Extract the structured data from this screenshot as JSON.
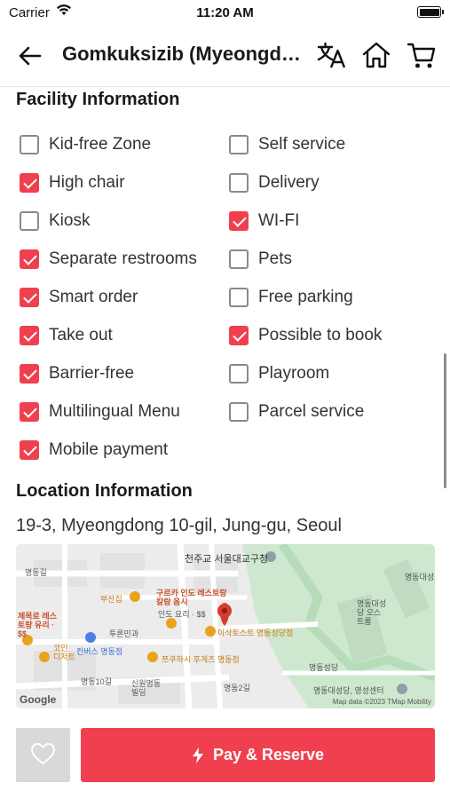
{
  "status_bar": {
    "carrier": "Carrier",
    "time": "11:20 AM"
  },
  "header": {
    "title": "Gomkuksizib (Myeongdong)",
    "icons": [
      "back-arrow-icon",
      "translate-icon",
      "home-icon",
      "cart-icon"
    ]
  },
  "facility": {
    "title": "Facility Information",
    "items": [
      {
        "label": "Kid-free Zone",
        "checked": false
      },
      {
        "label": "Self service",
        "checked": false
      },
      {
        "label": "High chair",
        "checked": true
      },
      {
        "label": "Delivery",
        "checked": false
      },
      {
        "label": "Kiosk",
        "checked": false
      },
      {
        "label": "WI-FI",
        "checked": true
      },
      {
        "label": "Separate restrooms",
        "checked": true
      },
      {
        "label": "Pets",
        "checked": false
      },
      {
        "label": "Smart order",
        "checked": true
      },
      {
        "label": "Free parking",
        "checked": false
      },
      {
        "label": "Take out",
        "checked": true
      },
      {
        "label": "Possible to book",
        "checked": true
      },
      {
        "label": "Barrier-free",
        "checked": true
      },
      {
        "label": "Playroom",
        "checked": false
      },
      {
        "label": "Multilingual Menu",
        "checked": true
      },
      {
        "label": "Parcel service",
        "checked": false
      },
      {
        "label": "Mobile payment",
        "checked": true
      }
    ]
  },
  "location": {
    "title": "Location Information",
    "address": "19-3, Myeongdong 10-gil, Jung-gu, Seoul",
    "map": {
      "labels": {
        "l1": "천주교 서울대교구청",
        "l2": "부산집",
        "l3": "구르카 인도 레스토랑 칼람 옴시",
        "l4": "인도 요리 · $$",
        "l5": "이삭토스트 명동성당점",
        "l6": "코인 디저트",
        "l7": "컨버스 명동점",
        "l8": "쯔쿠하시 후게츠 명동점",
        "l9": "명동길",
        "l10": "명동성당",
        "l11": "명동대성당, 영성센터",
        "l12": "신원명동 빌딩",
        "l13": "명동대성당 오스트룸",
        "l14": "명동10길",
        "l15": "투론민과",
        "l16": "제목로 레스토랑 유리 · $$",
        "l17": "명동2길",
        "l18": "명동대성길"
      },
      "google": "Google",
      "credit": "Map data ©2023 TMap Mobility"
    }
  },
  "bottom": {
    "pay_label": "Pay & Reserve"
  },
  "colors": {
    "accent": "#f0404f",
    "fav_bg": "#d9d9d9",
    "text": "#333333"
  }
}
